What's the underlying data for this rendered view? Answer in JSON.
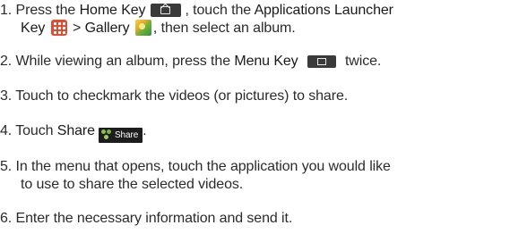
{
  "steps": [
    {
      "num": "1.",
      "line1": {
        "a": "Press the ",
        "home_key": "Home Key",
        "b": ", touch the ",
        "apps_key_1": "Applications Launcher"
      },
      "line2": {
        "apps_key_2": "Key",
        "c": " > ",
        "gallery": "Gallery",
        "d": ", then select an album."
      }
    },
    {
      "num": "2.",
      "a": "While viewing an album, press the ",
      "menu_key": "Menu Key",
      "b": " twice."
    },
    {
      "num": "3.",
      "text": "Touch to checkmark the videos (or pictures) to share."
    },
    {
      "num": "4.",
      "a": "Touch ",
      "share": "Share",
      "button_label": "Share",
      "b": "."
    },
    {
      "num": "5.",
      "line1": "In the menu that opens, touch the application you would like",
      "line2": "to use to share the selected videos."
    },
    {
      "num": "6.",
      "text": "Enter the necessary information and send it."
    }
  ],
  "icons": {
    "home": "home-key-icon",
    "apps": "applications-launcher-icon",
    "gallery": "gallery-icon",
    "menu": "menu-key-icon",
    "share": "share-icon"
  },
  "colors": {
    "text": "#2b2b2b",
    "key_bg": "#3a3a3a",
    "apps_red": "#e34b2e",
    "share_bg": "#1d1d1d"
  }
}
